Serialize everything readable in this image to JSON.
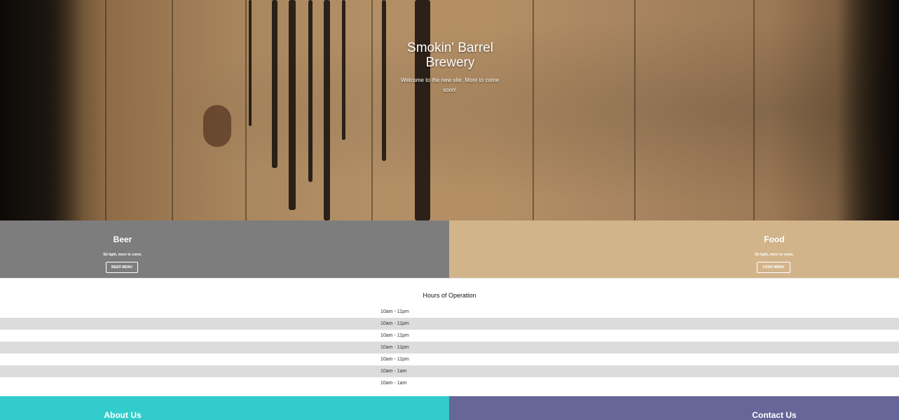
{
  "hero": {
    "title": "Smokin' Barrel Brewery",
    "subtitle": "Welcome to the new site. More to come soon!"
  },
  "menus": {
    "beer": {
      "heading": "Beer",
      "text": "Sit tight, more to come.",
      "button": "BEER MENU"
    },
    "food": {
      "heading": "Food",
      "text": "Sit tight, more to come.",
      "button": "FOOD MENU"
    }
  },
  "hours": {
    "heading": "Hours of Operation",
    "rows": [
      "10am - 11pm",
      "10am - 11pm",
      "10am - 11pm",
      "10am - 11pm",
      "10am - 11pm",
      "10am - 1am",
      "10am - 1am"
    ]
  },
  "sections": {
    "about": "About Us",
    "contact": "Contact Us"
  },
  "colors": {
    "beer_panel": "#7d7d7d",
    "food_panel": "#d2b48a",
    "about_panel": "#33cccc",
    "contact_panel": "#666699",
    "alt_row": "#dcdcdc"
  }
}
